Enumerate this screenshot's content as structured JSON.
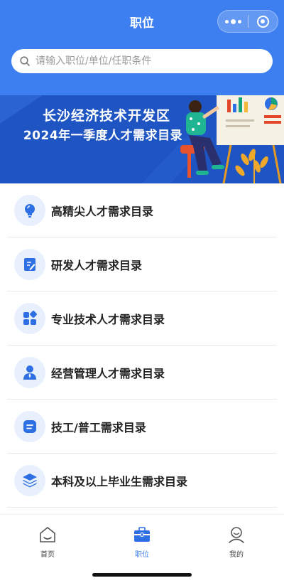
{
  "header": {
    "title": "职位",
    "capsule": {
      "more_icon": "more-dots-icon",
      "close_icon": "target-circle-icon"
    }
  },
  "search": {
    "placeholder": "请输入职位/单位/任职条件",
    "value": "",
    "icon": "search-icon"
  },
  "banner": {
    "line1": "长沙经济技术开发区",
    "line2": "2024年一季度人才需求目录"
  },
  "menu": {
    "items": [
      {
        "label": "高精尖人才需求目录",
        "icon": "lightbulb-icon"
      },
      {
        "label": "研发人才需求目录",
        "icon": "document-edit-icon"
      },
      {
        "label": "专业技术人才需求目录",
        "icon": "grid-apps-icon"
      },
      {
        "label": "经营管理人才需求目录",
        "icon": "person-tie-icon"
      },
      {
        "label": "技工/普工需求目录",
        "icon": "list-card-icon"
      },
      {
        "label": "本科及以上毕业生需求目录",
        "icon": "layers-icon"
      }
    ]
  },
  "tabbar": {
    "items": [
      {
        "label": "首页",
        "icon": "home-icon",
        "active": false
      },
      {
        "label": "职位",
        "icon": "briefcase-icon",
        "active": true
      },
      {
        "label": "我的",
        "icon": "user-icon",
        "active": false
      }
    ]
  },
  "colors": {
    "primary": "#3d7ff0",
    "banner": "#1f55c2",
    "icon_bg": "#e8f0fd",
    "icon_fg": "#2f6fe4"
  }
}
